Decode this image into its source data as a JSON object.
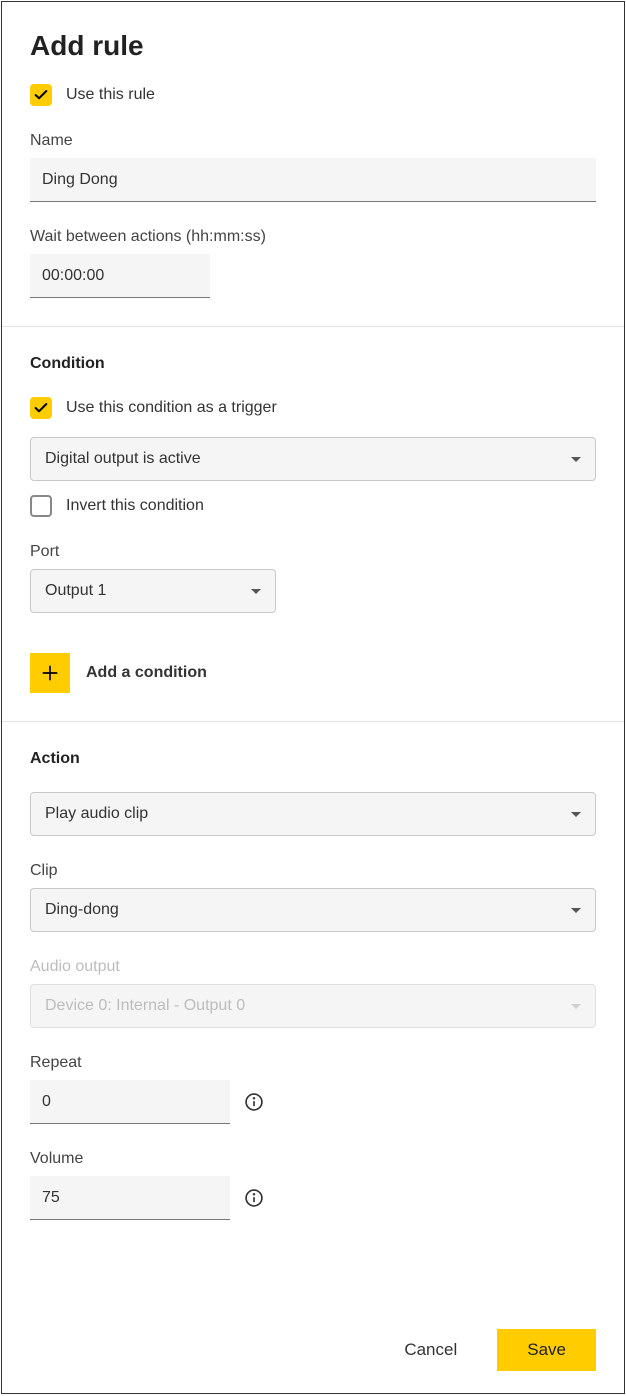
{
  "header": {
    "title": "Add rule",
    "use_rule_label": "Use this rule",
    "use_rule_checked": true,
    "name_label": "Name",
    "name_value": "Ding Dong",
    "wait_label": "Wait between actions (hh:mm:ss)",
    "wait_value": "00:00:00"
  },
  "condition": {
    "title": "Condition",
    "use_as_trigger_label": "Use this condition as a trigger",
    "use_as_trigger_checked": true,
    "type_value": "Digital output is active",
    "invert_label": "Invert this condition",
    "invert_checked": false,
    "port_label": "Port",
    "port_value": "Output 1",
    "add_label": "Add a condition"
  },
  "action": {
    "title": "Action",
    "type_value": "Play audio clip",
    "clip_label": "Clip",
    "clip_value": "Ding-dong",
    "audio_output_label": "Audio output",
    "audio_output_value": "Device 0: Internal - Output 0",
    "repeat_label": "Repeat",
    "repeat_value": "0",
    "volume_label": "Volume",
    "volume_value": "75"
  },
  "footer": {
    "cancel": "Cancel",
    "save": "Save"
  }
}
